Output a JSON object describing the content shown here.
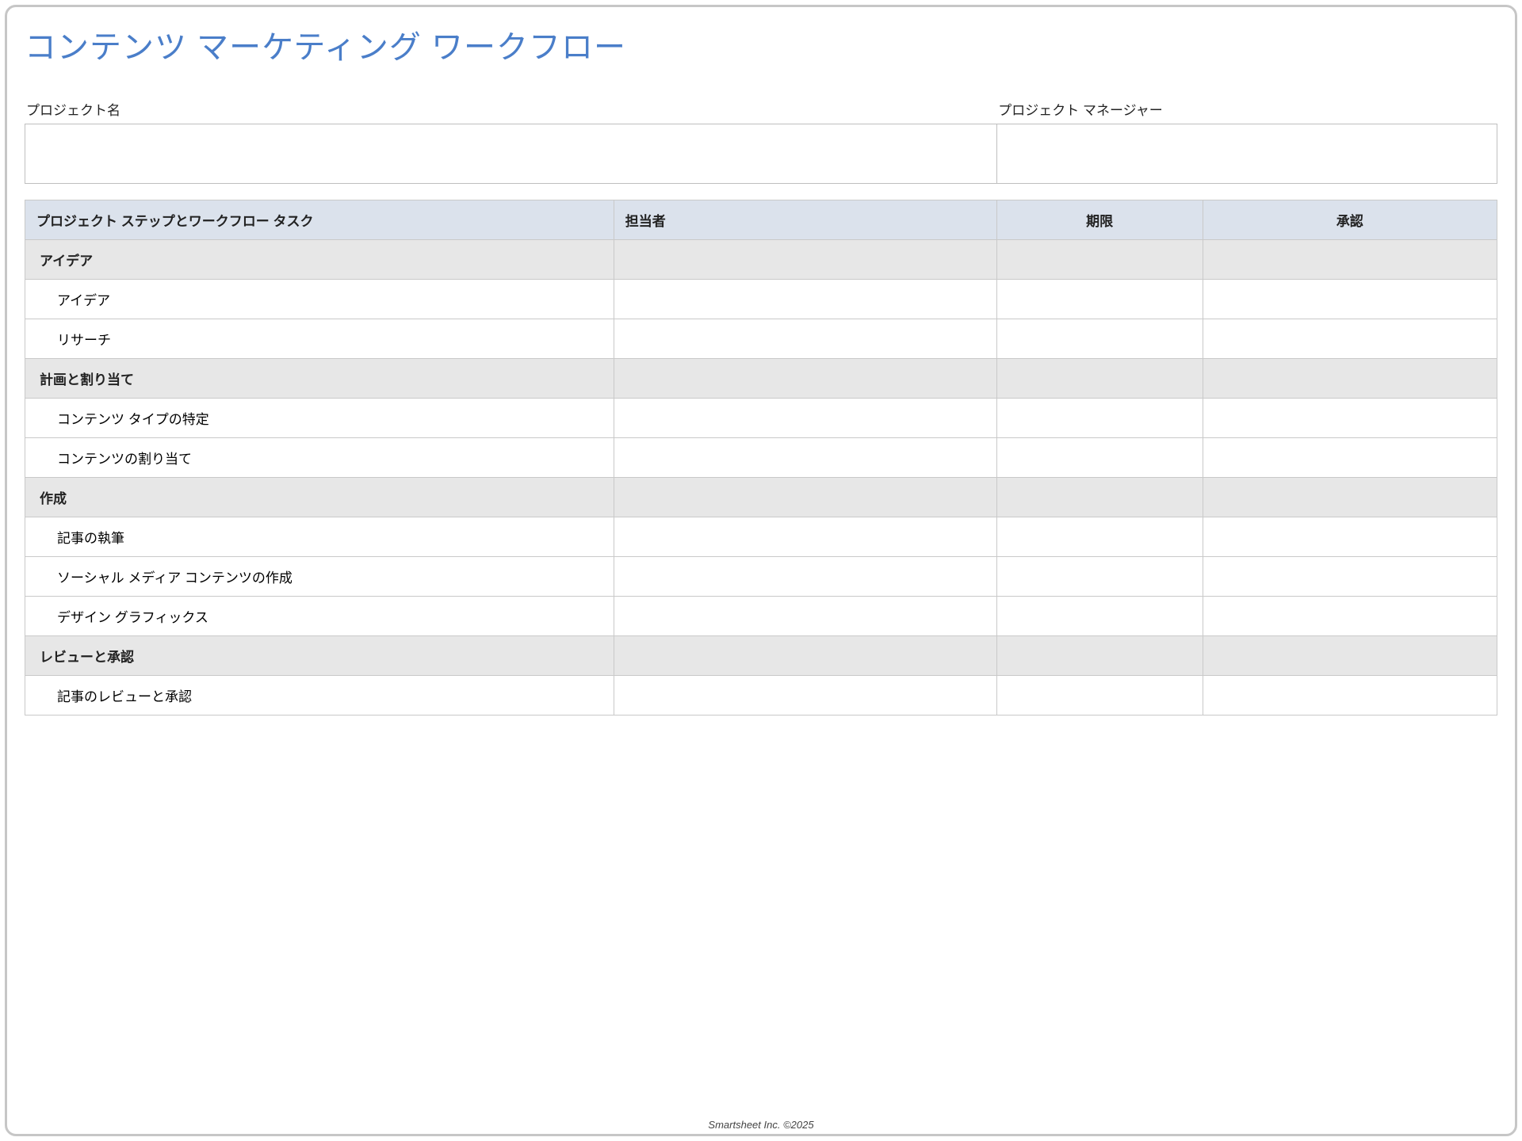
{
  "title": "コンテンツ マーケティング ワークフロー",
  "meta": {
    "project_name_label": "プロジェクト名",
    "project_name_value": "",
    "project_manager_label": "プロジェクト マネージャー",
    "project_manager_value": ""
  },
  "table": {
    "headers": {
      "step": "プロジェクト ステップとワークフロー タスク",
      "owner": "担当者",
      "due": "期限",
      "approval": "承認"
    },
    "rows": [
      {
        "type": "section",
        "step": "アイデア",
        "owner": "",
        "due": "",
        "approval": ""
      },
      {
        "type": "task",
        "step": "アイデア",
        "owner": "",
        "due": "",
        "approval": ""
      },
      {
        "type": "task",
        "step": "リサーチ",
        "owner": "",
        "due": "",
        "approval": ""
      },
      {
        "type": "section",
        "step": "計画と割り当て",
        "owner": "",
        "due": "",
        "approval": ""
      },
      {
        "type": "task",
        "step": "コンテンツ タイプの特定",
        "owner": "",
        "due": "",
        "approval": ""
      },
      {
        "type": "task",
        "step": "コンテンツの割り当て",
        "owner": "",
        "due": "",
        "approval": ""
      },
      {
        "type": "section",
        "step": "作成",
        "owner": "",
        "due": "",
        "approval": ""
      },
      {
        "type": "task",
        "step": "記事の執筆",
        "owner": "",
        "due": "",
        "approval": ""
      },
      {
        "type": "task",
        "step": "ソーシャル メディア コンテンツの作成",
        "owner": "",
        "due": "",
        "approval": ""
      },
      {
        "type": "task",
        "step": "デザイン グラフィックス",
        "owner": "",
        "due": "",
        "approval": ""
      },
      {
        "type": "section",
        "step": "レビューと承認",
        "owner": "",
        "due": "",
        "approval": ""
      },
      {
        "type": "task",
        "step": "記事のレビューと承認",
        "owner": "",
        "due": "",
        "approval": ""
      }
    ]
  },
  "footer": "Smartsheet Inc. ©2025"
}
